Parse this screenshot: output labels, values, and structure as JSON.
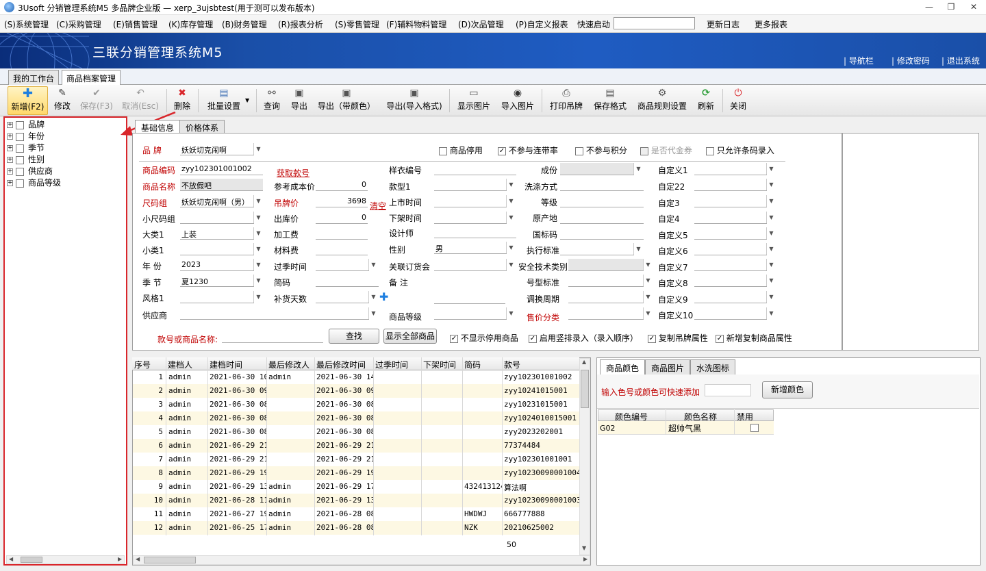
{
  "window": {
    "title": "3Usoft 分销管理系统M5 多品牌企业版 — xerp_3ujsbtest(用于测可以发布版本)",
    "min": "—",
    "restore": "❐",
    "close": "✕"
  },
  "menu": {
    "items": [
      "(S)系统管理",
      "(C)采购管理",
      "(E)销售管理",
      "(K)库存管理",
      "(B)财务管理",
      "(R)报表分析",
      "(S)零售管理",
      "(F)辅料物料管理",
      "(D)次品管理",
      "(P)自定义报表"
    ],
    "quick_start": "快速启动",
    "changelog": "更新日志",
    "more_reports": "更多报表"
  },
  "banner": {
    "title": "三联分销管理系统M5",
    "nav": "导航栏",
    "change_password": "修改密码",
    "logout": "退出系统"
  },
  "tabs": {
    "workbench": "我的工作台",
    "product_archive": "商品档案管理"
  },
  "toolbar": {
    "new": "新增(F2)",
    "edit": "修改",
    "save": "保存(F3)",
    "cancel": "取消(Esc)",
    "delete": "删除",
    "batch": "批量设置",
    "query": "查询",
    "export": "导出",
    "export_color": "导出（带颜色）",
    "export_import": "导出(导入格式)",
    "show_image": "显示图片",
    "import_image": "导入图片",
    "print_tag": "打印吊牌",
    "save_format": "保存格式",
    "rules": "商品规则设置",
    "refresh": "刷新",
    "close": "关闭"
  },
  "tree": {
    "items": [
      "品牌",
      "年份",
      "季节",
      "性别",
      "供应商",
      "商品等级"
    ]
  },
  "form": {
    "tabs": {
      "basic": "基础信息",
      "price": "价格体系"
    },
    "brand_label": "品 牌",
    "brand_value": "妖妖切克闹啊",
    "top_checks": {
      "disabled": "商品停用",
      "no_discount": "不参与连带率",
      "no_points": "不参与积分",
      "voucher": "是否代金券",
      "barcode_only": "只允许条码录入"
    },
    "code_label": "商品编码",
    "code_value": "zyy102301001002",
    "fetch_code": "获取款号",
    "name_label": "商品名称",
    "name_value": "不放假吧",
    "size_label": "尺码组",
    "size_value": "妖妖切克闹啊（男）",
    "small_size_label": "小尺码组",
    "cat1_label": "大类1",
    "cat1_value": "上装",
    "subcat1_label": "小类1",
    "year_label": "年 份",
    "year_value": "2023",
    "season_label": "季 节",
    "season_value": "夏1230",
    "style_label": "风格1",
    "supplier_label": "供应商",
    "ref_cost_label": "参考成本价",
    "ref_cost_value": "0",
    "tag_price_label": "吊牌价",
    "tag_price_value": "3698",
    "clear": "清空",
    "out_price_label": "出库价",
    "out_price_value": "0",
    "process_fee_label": "加工费",
    "material_fee_label": "材料费",
    "season_end_label": "过季时间",
    "short_code_label": "简码",
    "restock_label": "补货天数",
    "sample_no_label": "样衣编号",
    "model1_label": "款型1",
    "launch_label": "上市时间",
    "off_label": "下架时间",
    "designer_label": "设计师",
    "gender_label": "性别",
    "gender_value": "男",
    "order_fair_label": "关联订货会",
    "remark_label": "备 注",
    "grade_label": "商品等级",
    "composition_label": "成份",
    "wash_label": "洗涤方式",
    "level_label": "等级",
    "origin_label": "原产地",
    "gb_label": "国标码",
    "standard_label": "执行标准",
    "safety_label": "安全技术类别",
    "size_std_label": "号型标准",
    "swap_label": "调换周期",
    "sale_class_label": "售价分类",
    "custom_labels": [
      "自定义1",
      "自定22",
      "自定3",
      "自定4",
      "自定义5",
      "自定义6",
      "自定义7",
      "自定义8",
      "自定义9",
      "自定义10"
    ],
    "search_label": "款号或商品名称:",
    "search_button": "查找",
    "show_all_button": "显示全部商品",
    "bottom_checks": {
      "hide_disabled": "不显示停用商品",
      "vertical_entry": "启用竖排录入（录入顺序）",
      "copy_tag": "复制吊牌属性",
      "copy_new": "新增复制商品属性"
    }
  },
  "grid": {
    "headers": [
      "序号",
      "建档人",
      "建档时间",
      "最后修改人",
      "最后修改时间",
      "过季时间",
      "下架时间",
      "简码",
      "款号"
    ],
    "rows": [
      [
        "1",
        "admin",
        "2021-06-30 10",
        "admin",
        "2021-06-30 14:",
        "",
        "",
        "",
        "zyy102301001002"
      ],
      [
        "2",
        "admin",
        "2021-06-30 09",
        "",
        "2021-06-30 09:",
        "",
        "",
        "",
        "zyy10241015001"
      ],
      [
        "3",
        "admin",
        "2021-06-30 08",
        "",
        "2021-06-30 08:",
        "",
        "",
        "",
        "zyy10231015001"
      ],
      [
        "4",
        "admin",
        "2021-06-30 08",
        "",
        "2021-06-30 08:",
        "",
        "",
        "",
        "zyy1024010015001"
      ],
      [
        "5",
        "admin",
        "2021-06-30 08",
        "",
        "2021-06-30 08:",
        "",
        "",
        "",
        "zyy2023202001"
      ],
      [
        "6",
        "admin",
        "2021-06-29 21",
        "",
        "2021-06-29 21:",
        "",
        "",
        "",
        "77374484"
      ],
      [
        "7",
        "admin",
        "2021-06-29 21",
        "",
        "2021-06-29 21:",
        "",
        "",
        "",
        "zyy102301001001"
      ],
      [
        "8",
        "admin",
        "2021-06-29 19",
        "",
        "2021-06-29 19:",
        "",
        "",
        "",
        "zyy10230090001004"
      ],
      [
        "9",
        "admin",
        "2021-06-29 13",
        "admin",
        "2021-06-29 17:",
        "",
        "",
        "432413124",
        "算法啊"
      ],
      [
        "10",
        "admin",
        "2021-06-28 11",
        "admin",
        "2021-06-29 13:",
        "",
        "",
        "",
        "zyy10230090001003"
      ],
      [
        "11",
        "admin",
        "2021-06-27 19",
        "admin",
        "2021-06-28 08:",
        "",
        "",
        "HWDWJ",
        "666777888"
      ],
      [
        "12",
        "admin",
        "2021-06-25 17",
        "admin",
        "2021-06-28 08:",
        "",
        "",
        "NZK",
        "20210625002"
      ]
    ],
    "total": "50"
  },
  "color": {
    "tabs": {
      "color": "商品颜色",
      "images": "商品图片",
      "wash_icons": "水洗图标"
    },
    "hint": "输入色号或颜色可快速添加",
    "add_button": "新增颜色",
    "headers": {
      "code": "颜色编号",
      "name": "颜色名称",
      "disabled": "禁用"
    },
    "row": {
      "code": "G02",
      "name": "超帅气黑"
    }
  }
}
